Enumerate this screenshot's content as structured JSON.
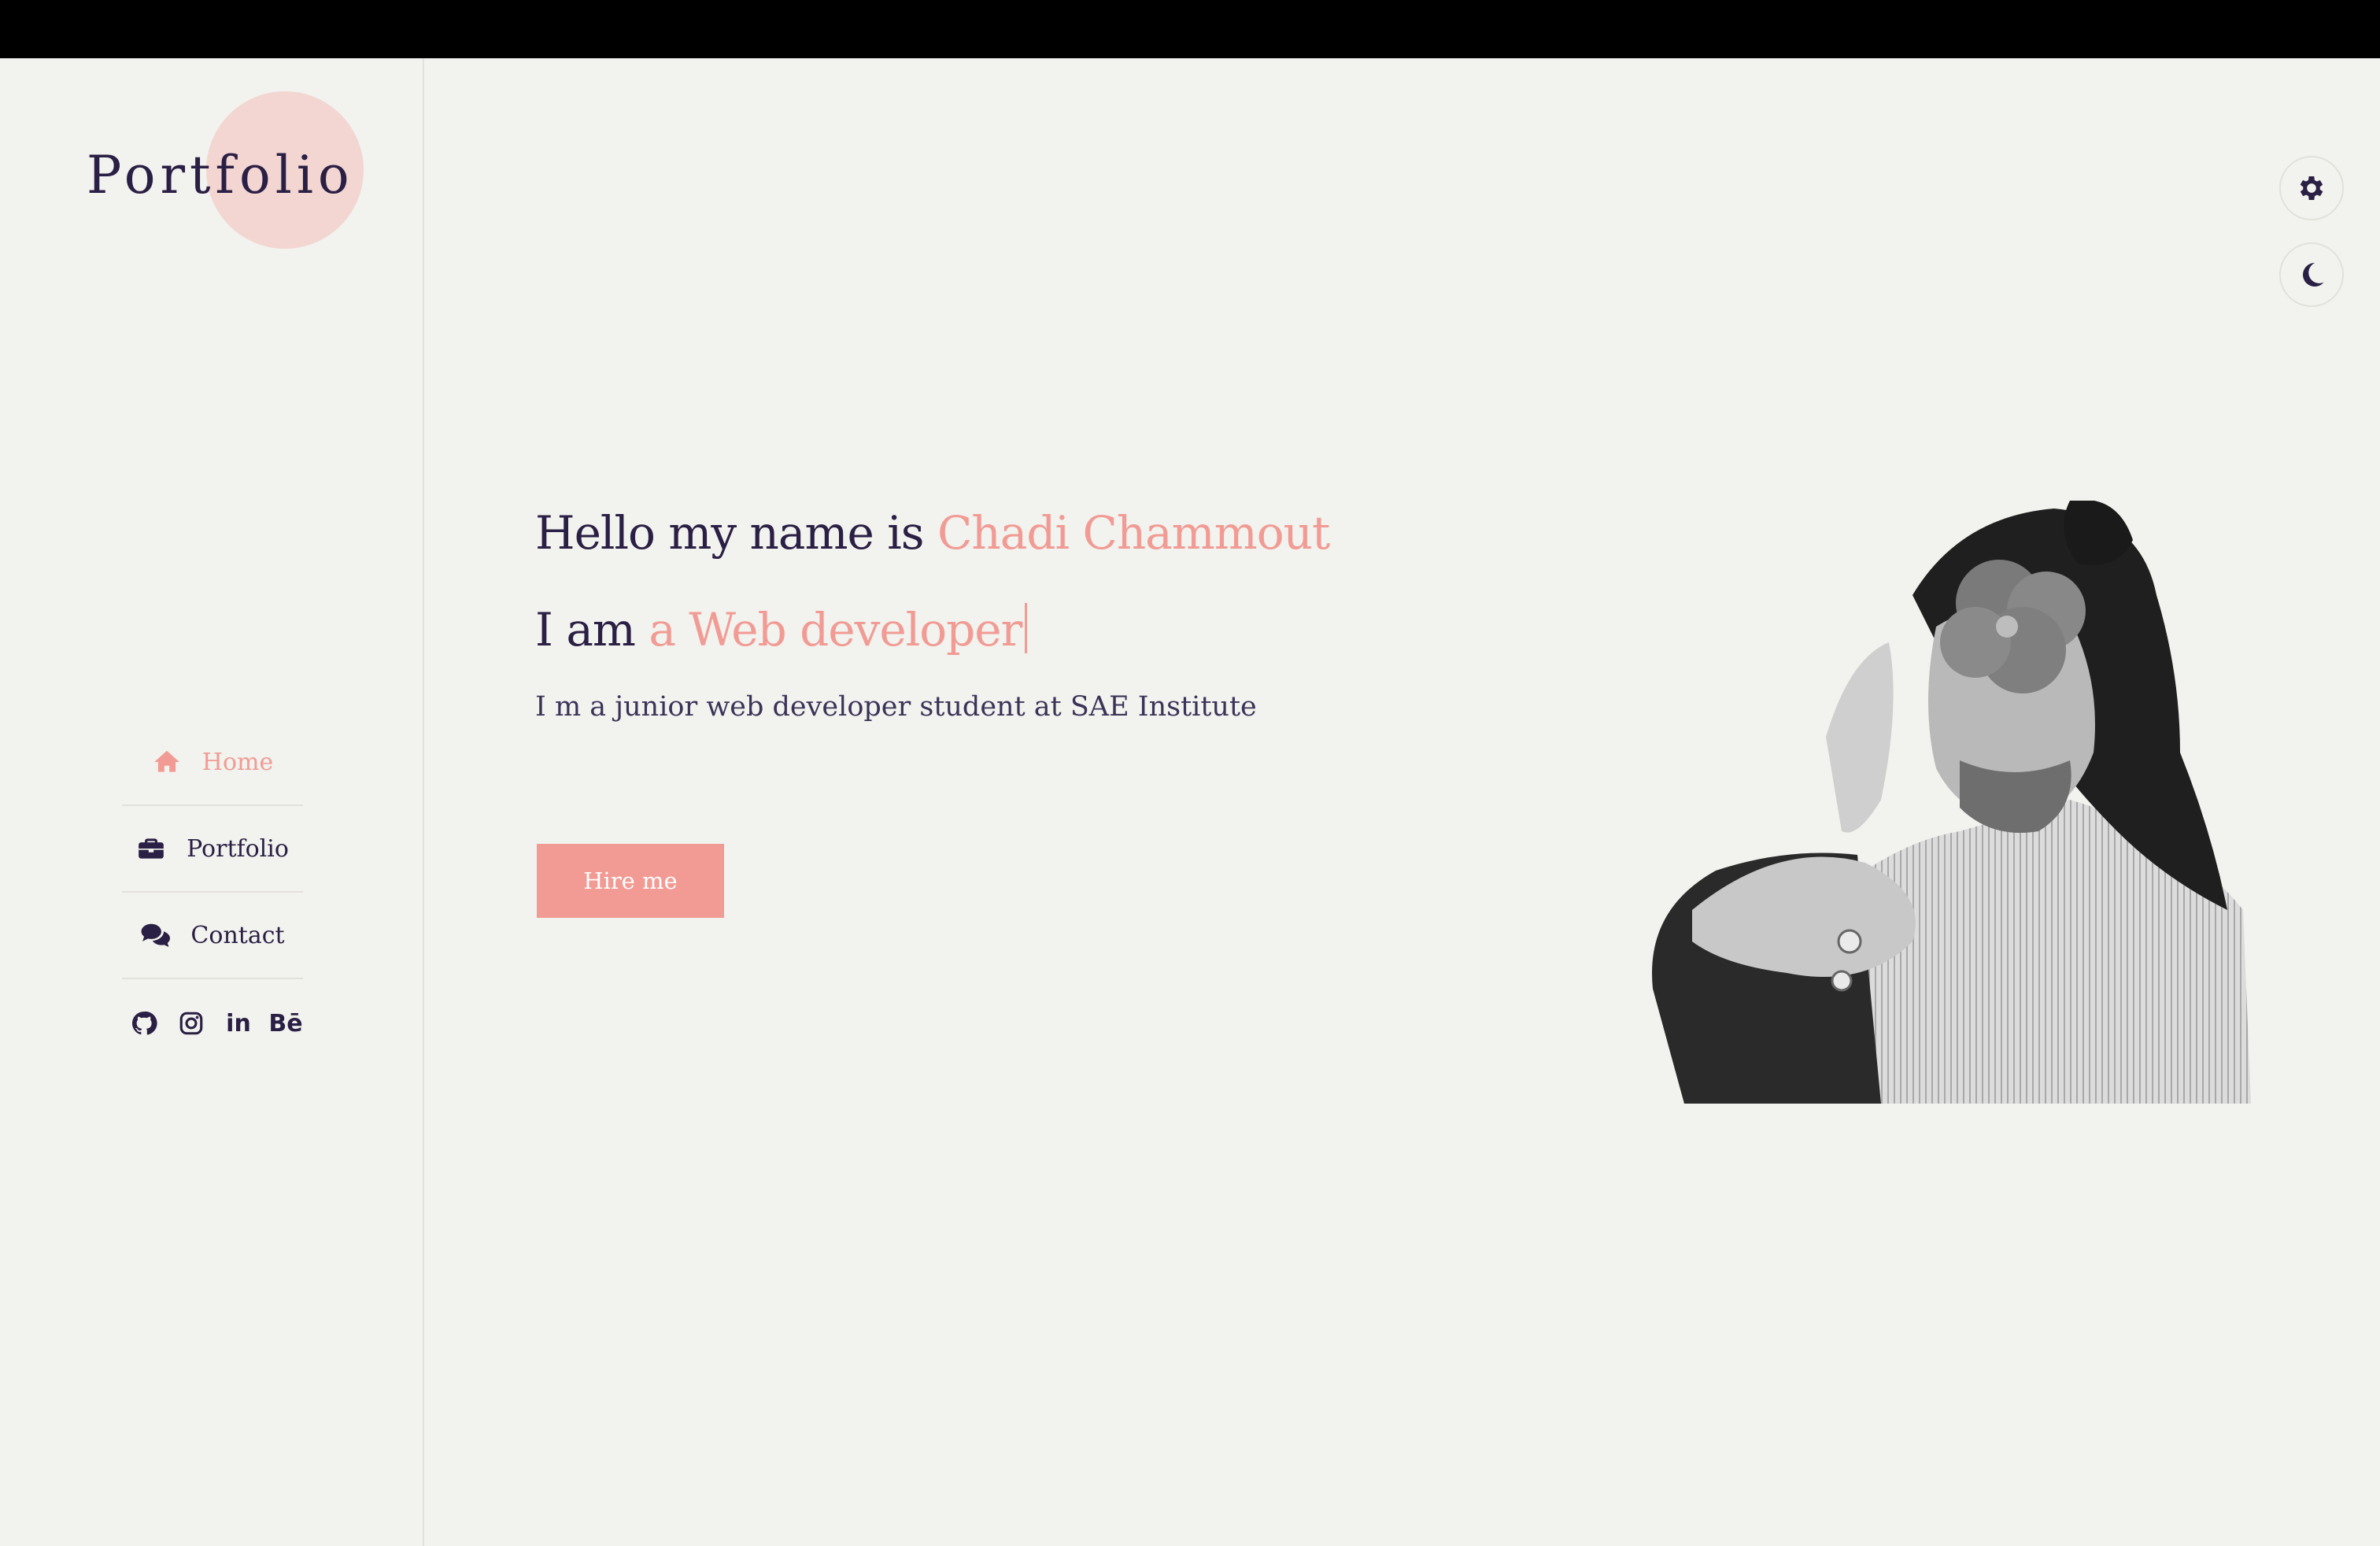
{
  "sidebar": {
    "logo_text": "Portfolio",
    "nav": [
      {
        "label": "Home",
        "icon": "home-icon",
        "active": true
      },
      {
        "label": "Portfolio",
        "icon": "briefcase-icon",
        "active": false
      },
      {
        "label": "Contact",
        "icon": "comments-icon",
        "active": false
      }
    ],
    "socials": [
      {
        "name": "github-icon"
      },
      {
        "name": "instagram-icon"
      },
      {
        "name": "linkedin-icon",
        "text": "in"
      },
      {
        "name": "behance-icon",
        "text": "Bē"
      }
    ]
  },
  "hero": {
    "greeting": "Hello  my name is",
    "name": "Chadi Chammout",
    "iam": "I am",
    "role": "a Web developer",
    "subtitle": "I m a junior web developer  student at SAE Institute",
    "button_label": "Hire me"
  },
  "controls": {
    "settings_icon": "gear-icon",
    "theme_icon": "moon-icon"
  },
  "colors": {
    "accent": "#f19b94",
    "text": "#2a1f44",
    "background": "#f2f2ee"
  }
}
